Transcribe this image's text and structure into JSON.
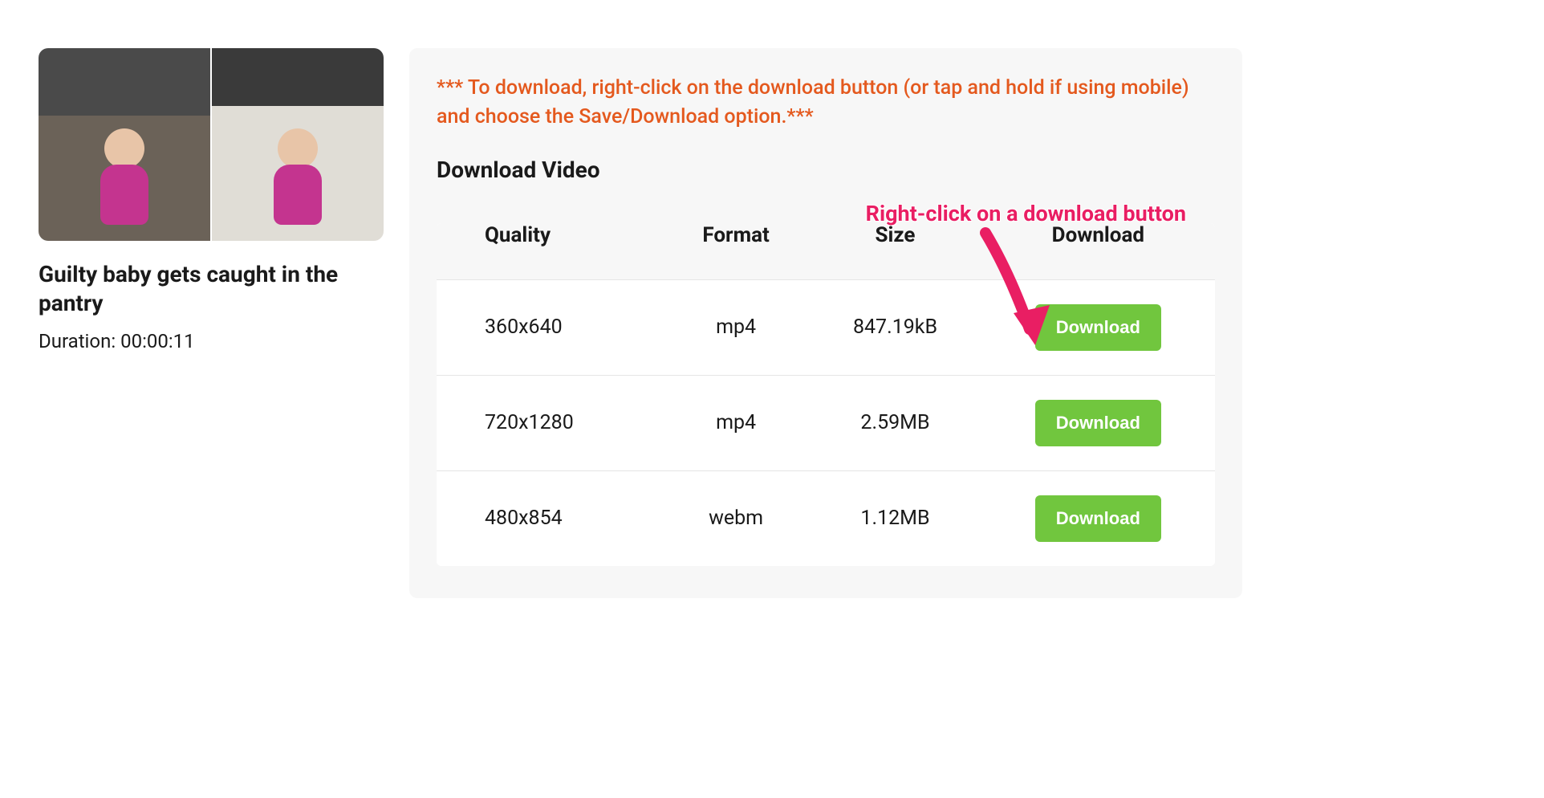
{
  "video": {
    "title": "Guilty baby gets caught in the pantry",
    "duration_label": "Duration: 00:00:11"
  },
  "panel": {
    "instruction": "*** To download, right-click on the download button (or tap and hold if using mobile) and choose the Save/Download option.***",
    "heading": "Download Video",
    "annotation": "Right-click on a download button"
  },
  "table": {
    "headers": {
      "quality": "Quality",
      "format": "Format",
      "size": "Size",
      "download": "Download"
    },
    "rows": [
      {
        "quality": "360x640",
        "format": "mp4",
        "size": "847.19kB",
        "button": "Download"
      },
      {
        "quality": "720x1280",
        "format": "mp4",
        "size": "2.59MB",
        "button": "Download"
      },
      {
        "quality": "480x854",
        "format": "webm",
        "size": "1.12MB",
        "button": "Download"
      }
    ]
  }
}
